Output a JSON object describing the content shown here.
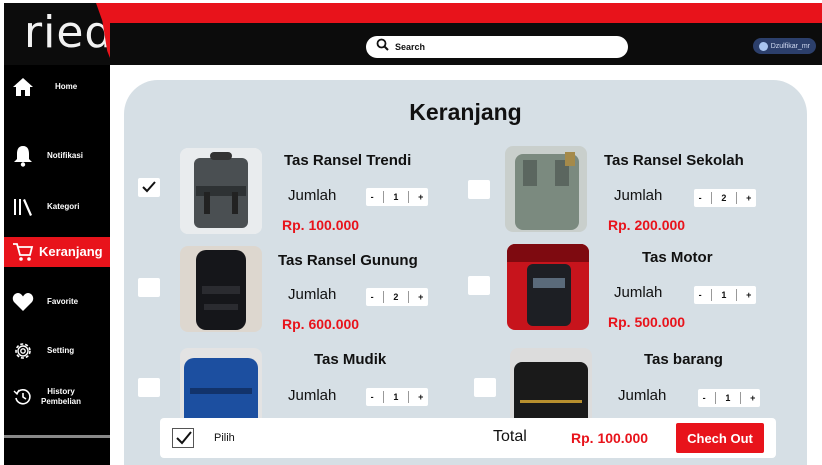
{
  "app": {
    "logo": "ried"
  },
  "header": {
    "search_label": "Search",
    "user_name": "Dzulfikar_mr"
  },
  "sidebar": {
    "items": [
      {
        "label": "Home",
        "icon": "home-icon"
      },
      {
        "label": "Notifikasi",
        "icon": "bell-icon"
      },
      {
        "label": "Kategori",
        "icon": "library-icon"
      },
      {
        "label": "Keranjang",
        "icon": "cart-icon",
        "active": true
      },
      {
        "label": "Favorite",
        "icon": "heart-icon"
      },
      {
        "label": "Setting",
        "icon": "gear-icon"
      },
      {
        "label": "History Pembelian",
        "icon": "history-icon"
      }
    ]
  },
  "page": {
    "title": "Keranjang"
  },
  "cart": {
    "qty_label": "Jumlah",
    "minus": "-",
    "plus": "+",
    "items": [
      {
        "name": "Tas Ransel Trendi",
        "qty": "1",
        "price": "Rp. 100.000",
        "checked": true
      },
      {
        "name": "Tas Ransel Sekolah",
        "qty": "2",
        "price": "Rp. 200.000",
        "checked": false
      },
      {
        "name": "Tas Ransel Gunung",
        "qty": "2",
        "price": "Rp. 600.000",
        "checked": false
      },
      {
        "name": "Tas Motor",
        "qty": "1",
        "price": "Rp. 500.000",
        "checked": false
      },
      {
        "name": "Tas Mudik",
        "qty": "1",
        "price": "",
        "checked": false
      },
      {
        "name": "Tas barang",
        "qty": "1",
        "price": "",
        "checked": false
      }
    ]
  },
  "footer": {
    "select_label": "Pilih",
    "total_label": "Total",
    "total_value": "Rp. 100.000",
    "checkout_label": "Chech Out"
  },
  "colors": {
    "accent": "#e8131b",
    "sidebar": "#000000",
    "panel": "#d6dfe5"
  }
}
